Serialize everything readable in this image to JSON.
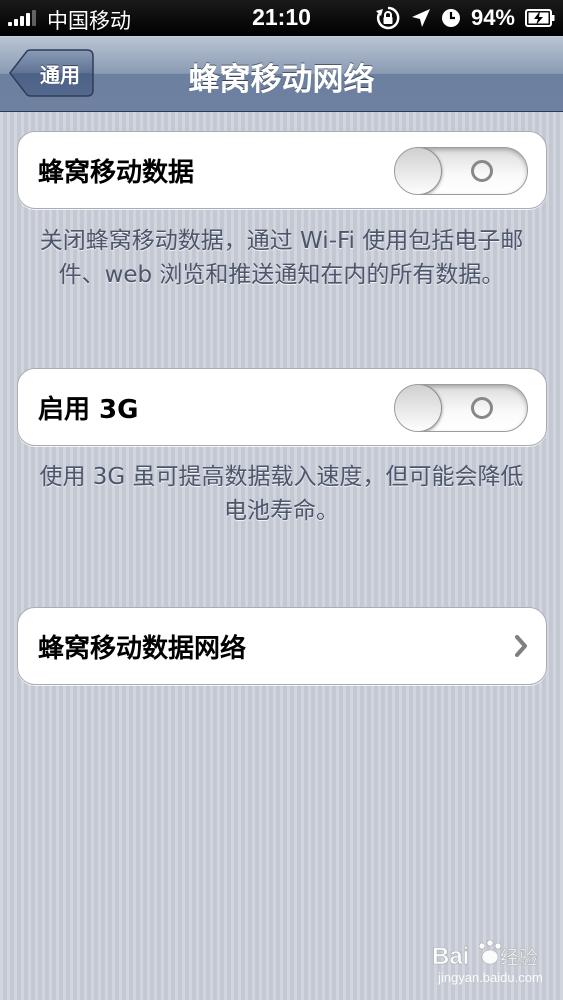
{
  "status_bar": {
    "carrier": "中国移动",
    "time": "21:10",
    "battery": "94%",
    "icons": [
      "signal-bars-icon",
      "orientation-lock-icon",
      "location-arrow-icon",
      "alarm-clock-icon",
      "battery-charging-icon"
    ]
  },
  "nav": {
    "back_label": "通用",
    "title": "蜂窝移动网络"
  },
  "cellular_data": {
    "label": "蜂窝移动数据",
    "state": "off",
    "footer": "关闭蜂窝移动数据，通过 Wi-Fi 使用包括电子邮件、web 浏览和推送通知在内的所有数据。"
  },
  "enable_3g": {
    "label": "启用 3G",
    "state": "off",
    "footer": "使用 3G 虽可提高数据载入速度，但可能会降低电池寿命。"
  },
  "cellular_network": {
    "label": "蜂窝移动数据网络",
    "icon": "chevron-right-icon"
  },
  "watermark": {
    "logo": "Bai du 经验",
    "url": "jingyan.baidu.com"
  },
  "colors": {
    "nav_blue": "#6e81a0",
    "background": "#c7ccd6",
    "footer_text": "#4c566c"
  }
}
